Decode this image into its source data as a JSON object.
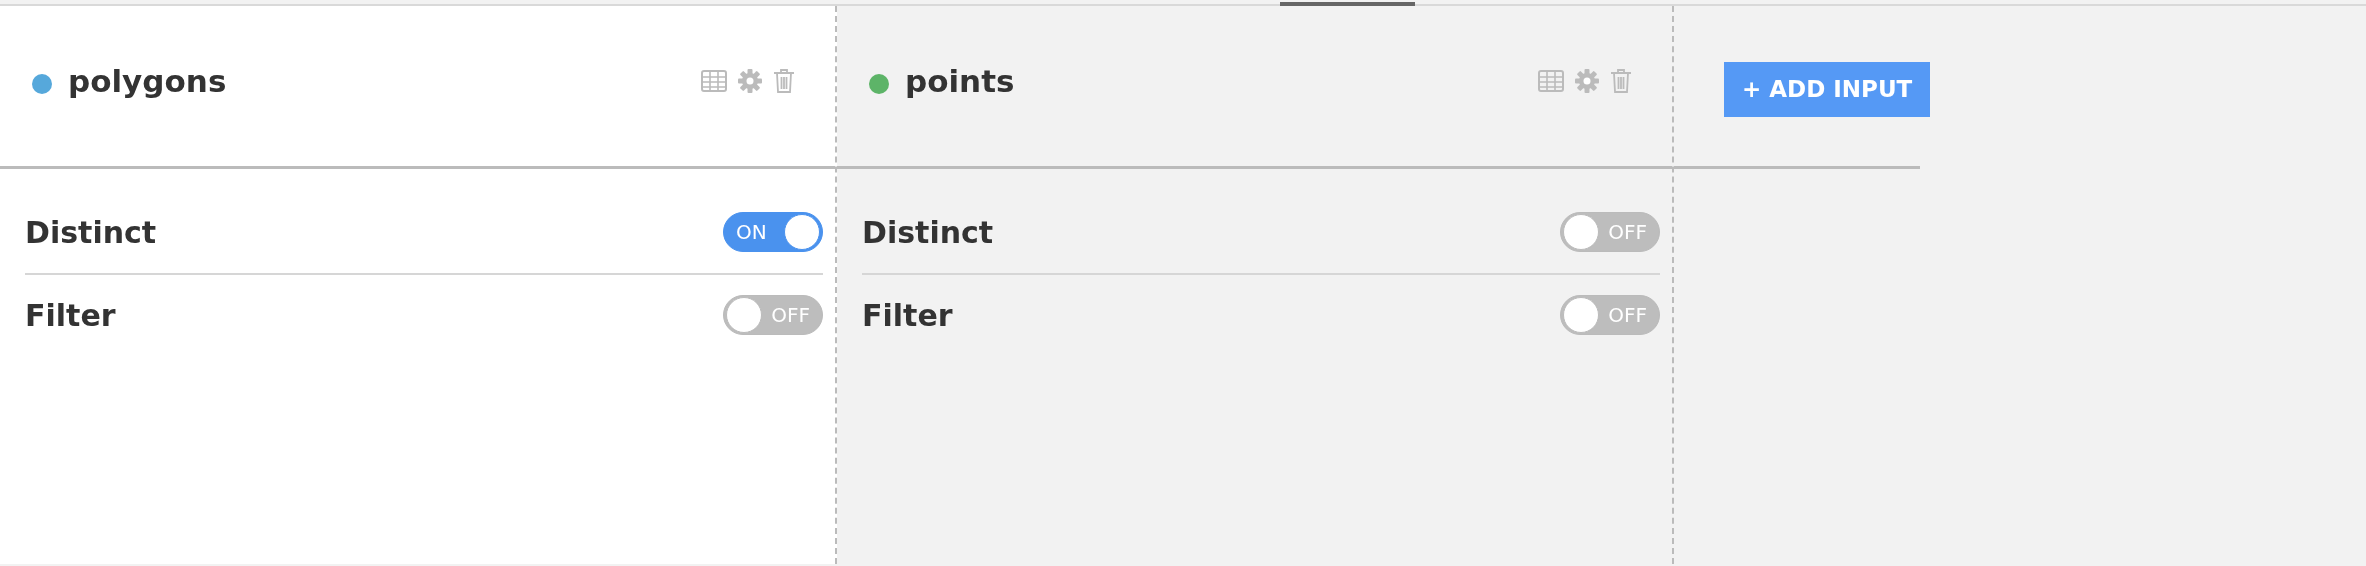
{
  "inputs": [
    {
      "name": "polygons",
      "color": "#56a8db",
      "settings": [
        {
          "label": "Distinct",
          "on": true,
          "toggle_text": "ON"
        },
        {
          "label": "Filter",
          "on": false,
          "toggle_text": "OFF"
        }
      ]
    },
    {
      "name": "points",
      "color": "#5db468",
      "settings": [
        {
          "label": "Distinct",
          "on": false,
          "toggle_text": "OFF"
        },
        {
          "label": "Filter",
          "on": false,
          "toggle_text": "OFF"
        }
      ]
    }
  ],
  "add_button": {
    "label": "+ ADD INPUT"
  }
}
